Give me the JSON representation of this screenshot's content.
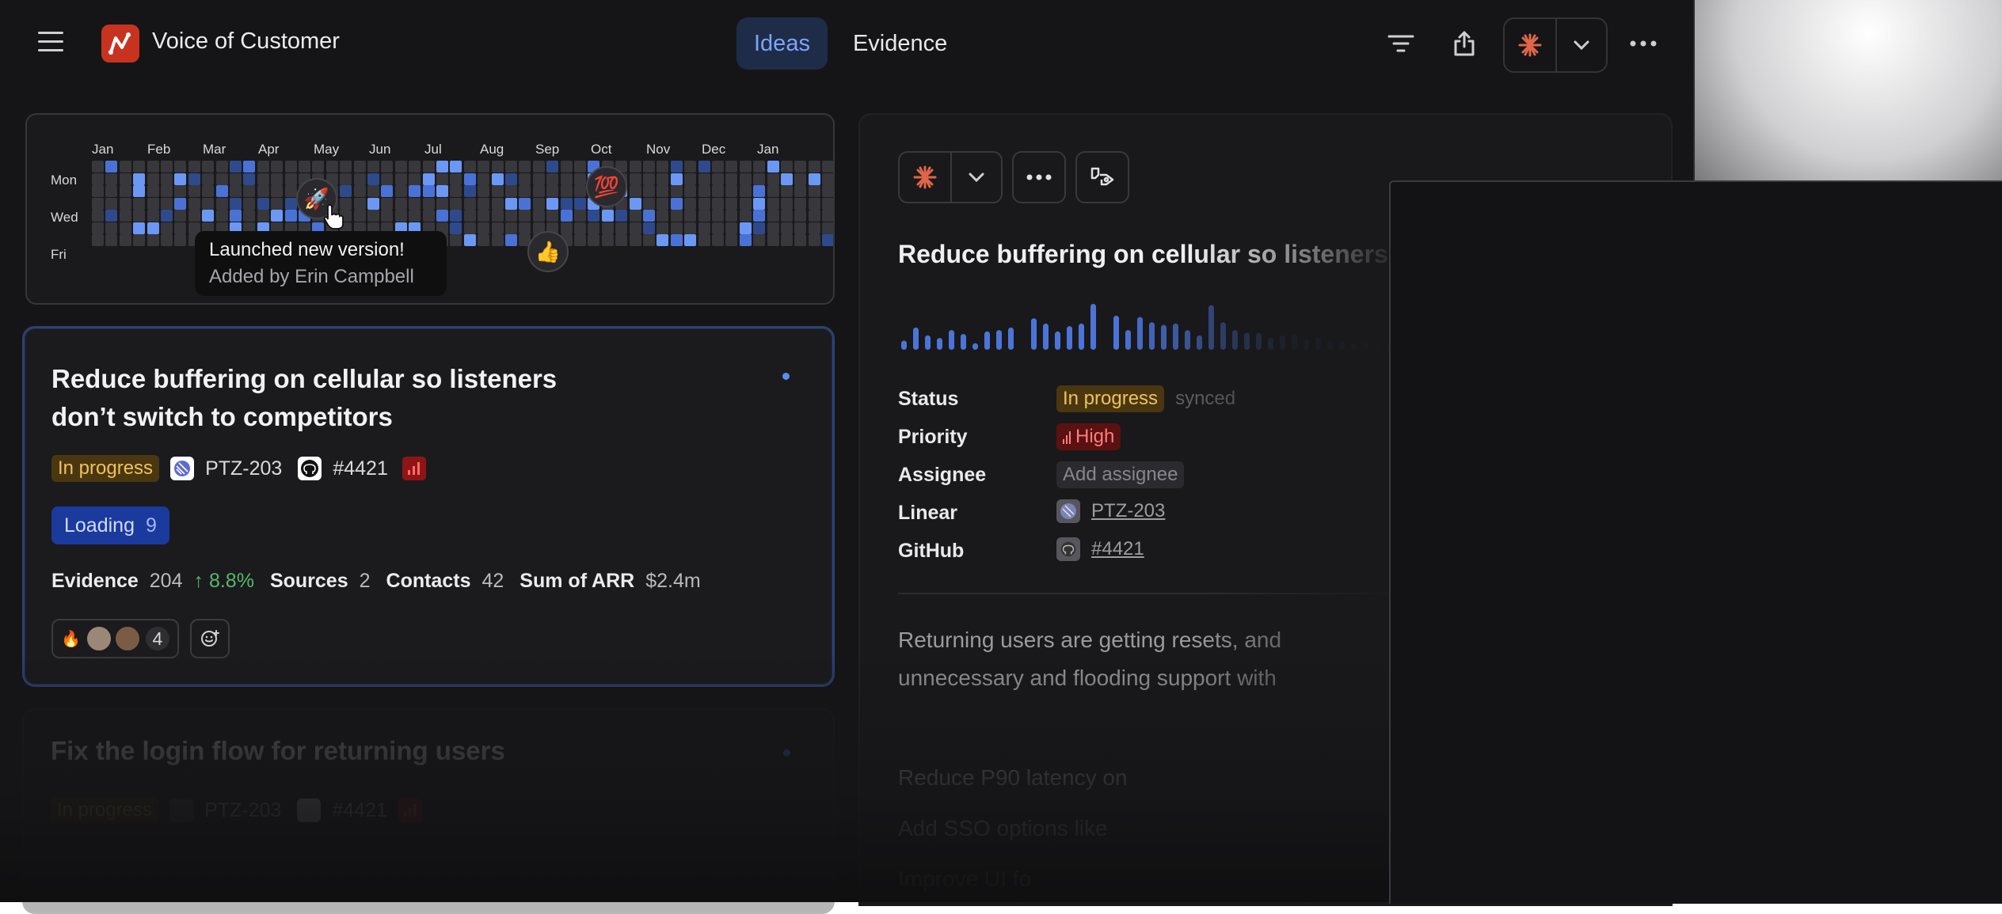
{
  "app": {
    "title": "Voice of Customer",
    "tabs": [
      {
        "label": "Ideas",
        "active": true
      },
      {
        "label": "Evidence",
        "active": false
      }
    ],
    "icons": [
      "menu-icon",
      "filter-icon",
      "share-icon",
      "asterisk-icon",
      "chevron-down-icon",
      "more-icon"
    ]
  },
  "heatmap": {
    "months": [
      "Jan",
      "Feb",
      "Mar",
      "Apr",
      "May",
      "Jun",
      "Jul",
      "Aug",
      "Sep",
      "Oct",
      "Nov",
      "Dec",
      "Jan"
    ],
    "day_labels": [
      "Mon",
      "Wed",
      "Fri"
    ],
    "markers": [
      {
        "emoji": "🚀",
        "name": "rocket"
      },
      {
        "emoji": "💯",
        "name": "hundred"
      },
      {
        "emoji": "👍",
        "name": "thumbs-up"
      }
    ],
    "tooltip": {
      "title": "Launched new version!",
      "subtitle": "Added by Erin Campbell"
    },
    "colors": {
      "empty": "#37373c",
      "low": "#2e4a8c",
      "mid": "#4a72d6",
      "high": "#6b98f5"
    }
  },
  "ideas": [
    {
      "title": "Reduce buffering on cellular so listeners don’t switch to competitors",
      "status": "In progress",
      "linear_id": "PTZ-203",
      "github_id": "#4421",
      "tag": {
        "label": "Loading",
        "count": "9"
      },
      "stats": {
        "evidence_label": "Evidence",
        "evidence": "204",
        "evidence_change": "↑ 8.8%",
        "sources_label": "Sources",
        "sources": "2",
        "contacts_label": "Contacts",
        "contacts": "42",
        "arr_label": "Sum of ARR",
        "arr": "$2.4m"
      },
      "reactions": {
        "emoji": "🔥",
        "count": "4"
      }
    },
    {
      "title": "Fix the login flow for returning users",
      "status": "In progress",
      "linear_id": "PTZ-203",
      "github_id": "#4421"
    }
  ],
  "detail": {
    "title": "Reduce buffering on cellular so listeners",
    "sparkline": [
      14,
      34,
      22,
      18,
      30,
      24,
      10,
      28,
      30,
      34,
      48,
      40,
      28,
      36,
      40,
      70,
      52,
      30,
      50,
      42,
      38,
      40,
      30,
      22,
      68,
      42,
      30,
      26,
      26,
      18,
      22,
      24,
      16,
      20,
      14,
      12,
      10,
      12,
      8,
      10,
      8,
      6
    ],
    "props": [
      {
        "label": "Status",
        "value": "In progress",
        "extra": "synced"
      },
      {
        "label": "Priority",
        "value": "High"
      },
      {
        "label": "Assignee",
        "value": "Add assignee"
      },
      {
        "label": "Linear",
        "value": "PTZ-203"
      },
      {
        "label": "GitHub",
        "value": "#4421"
      }
    ],
    "paragraph": "Returning users are getting resets, and unnecessary and flooding support with",
    "bullets": [
      "Reduce P90 latency on",
      "Add SSO options like",
      "Improve UI fo"
    ]
  }
}
